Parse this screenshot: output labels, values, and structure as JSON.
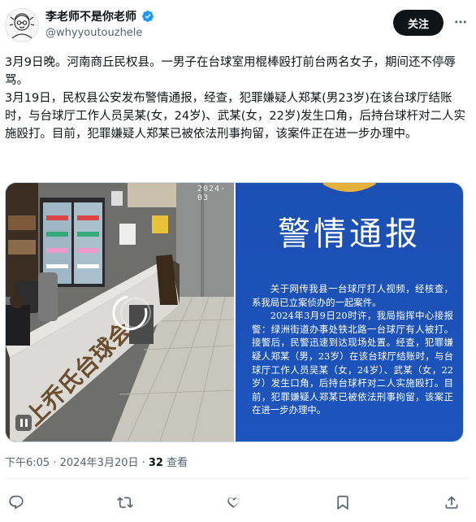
{
  "post": {
    "author_name": "李老师不是你老师",
    "handle": "@whyyoutouzhele",
    "follow_label": "关注",
    "paragraphs": [
      "3月9日晚。河南商丘民权县。一男子在台球室用棍棒殴打前台两名女子，期间还不停辱骂。",
      "3月19日，民权县公安发布警情通报，经查，犯罪嫌疑人郑某(男23岁)在该台球厅结账时，与台球厅工作人员吴某(女，24岁)、武某(女，22岁)发生口角，后持台球杆对二人实施殴打。目前，犯罪嫌疑人郑某已被依法刑事拘留，该案件正在进一步办理中。"
    ],
    "time": "下午6:05 · 2024年3月20日 · ",
    "views_count": "32",
    "views_label": " 查看"
  },
  "video": {
    "overlay_timestamp": "2024-03",
    "sign_text": "上乔氏台球会"
  },
  "notice": {
    "title": "警情通报",
    "body": [
      "关于网传我县一台球厅打人视频，经核查，系我局已立案侦办的一起案件。",
      "2024年3月9日20时许，我局指挥中心接报警：绿洲街道办事处铁北路一台球厅有人被打。接警后，民警迅速到达现场处置。经查，犯罪嫌疑人郑某（男，23岁）在该台球厅结账时，与台球厅工作人员吴某（女，24岁）、武某（女，22岁）发生口角，后持台球杆对二人实施殴打。目前，犯罪嫌疑人郑某已被依法刑事拘留，该案正在进一步办理中。"
    ]
  },
  "icons": {
    "verified": "verified-badge-icon",
    "more": "more-icon",
    "reply": "reply-icon",
    "retweet": "retweet-icon",
    "like": "like-icon",
    "bookmark": "bookmark-icon",
    "share": "share-icon",
    "pause": "pause-icon"
  },
  "colors": {
    "text": "#0f1419",
    "secondary": "#536471",
    "verified_blue": "#1d9bf0",
    "notice_blue": "#1b4fb3",
    "follow_bg": "#0f1419"
  }
}
